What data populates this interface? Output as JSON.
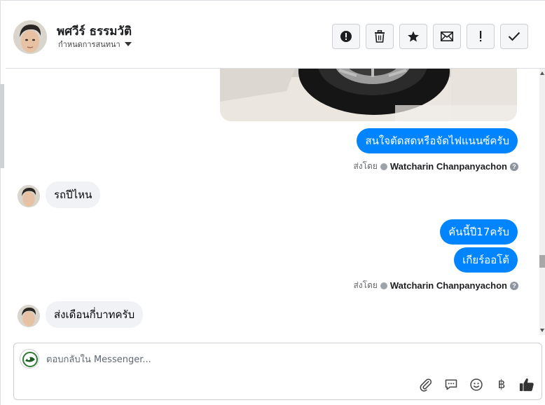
{
  "header": {
    "contact_name": "พศวีร์ ธรรมวัติ",
    "subtitle": "กำหนดการสนทนา",
    "toolbar": [
      {
        "name": "report-spam-button",
        "icon": "exclamation-circle-icon"
      },
      {
        "name": "delete-button",
        "icon": "trash-icon"
      },
      {
        "name": "star-button",
        "icon": "star-icon"
      },
      {
        "name": "mark-unread-button",
        "icon": "envelope-icon"
      },
      {
        "name": "follow-up-button",
        "icon": "exclamation-icon"
      },
      {
        "name": "mark-done-button",
        "icon": "checkmark-icon"
      }
    ]
  },
  "messages": {
    "outgoing_1": "สนใจตัดสดหรือจัดไฟแนนซ์ครับ",
    "sent_by_1": {
      "label": "ส่งโดย",
      "sender": "Watcharin Chanpanyachon"
    },
    "incoming_1": "รถปีไหน",
    "outgoing_2": "คันนี้ปี17ครับ",
    "outgoing_3": "เกียร์ออโต้",
    "sent_by_2": {
      "label": "ส่งโดย",
      "sender": "Watcharin Chanpanyachon"
    },
    "incoming_2": "ส่งเดือนกี่บาทครับ"
  },
  "composer": {
    "placeholder": "ตอบกลับใน Messenger...",
    "tools": [
      "paperclip-icon",
      "saved-reply-icon",
      "emoji-icon",
      "baht-icon",
      "thumbs-up-icon"
    ],
    "baht_symbol": "฿"
  },
  "colors": {
    "outgoing_bubble": "#0084ff",
    "incoming_bubble": "#f0f2f5",
    "divider": "#dadde1"
  }
}
